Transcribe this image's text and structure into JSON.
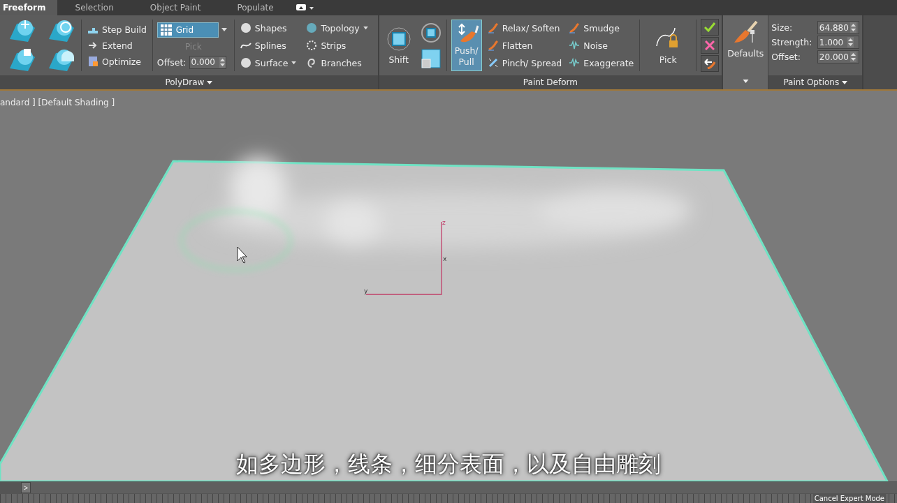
{
  "tabs": [
    {
      "label": "Freeform",
      "selected": true
    },
    {
      "label": "Selection",
      "selected": false
    },
    {
      "label": "Object Paint",
      "selected": false
    },
    {
      "label": "Populate",
      "selected": false
    }
  ],
  "polydraw": {
    "title": "PolyDraw",
    "tools": [
      {
        "label": "Step Build"
      },
      {
        "label": "Extend"
      },
      {
        "label": "Optimize"
      }
    ],
    "grid": {
      "label": "Grid"
    },
    "pick": {
      "label": "Pick",
      "disabled": true
    },
    "offset": {
      "label": "Offset:",
      "value": "0.000"
    },
    "draw_tools": [
      {
        "label": "Shapes",
        "dropdown": false
      },
      {
        "label": "Splines",
        "dropdown": false
      },
      {
        "label": "Surface",
        "dropdown": true
      },
      {
        "label": "Topology",
        "dropdown": true
      },
      {
        "label": "Strips",
        "dropdown": false
      },
      {
        "label": "Branches",
        "dropdown": false
      }
    ]
  },
  "paint_deform": {
    "title": "Paint Deform",
    "shift": "Shift",
    "push_pull": {
      "lines": [
        "Push/",
        "Pull"
      ],
      "selected": true
    },
    "brushes": [
      {
        "label": "Relax/ Soften"
      },
      {
        "label": "Flatten"
      },
      {
        "label": "Pinch/ Spread"
      },
      {
        "label": "Smudge"
      },
      {
        "label": "Noise"
      },
      {
        "label": "Exaggerate"
      }
    ],
    "pick": "Pick"
  },
  "defaults": {
    "label": "Defaults"
  },
  "paint_options": {
    "title": "Paint Options",
    "fields": [
      {
        "label": "Size:",
        "value": "64.880"
      },
      {
        "label": "Strength:",
        "value": "1.000"
      },
      {
        "label": "Offset:",
        "value": "20.000"
      }
    ]
  },
  "viewport": {
    "label": "andard ] [Default Shading ]",
    "axes": [
      "z",
      "x",
      "y"
    ]
  },
  "subtitle": "如多边形，线条，细分表面，以及自由雕刻",
  "status": {
    "expand": ">",
    "cancel": "Cancel Expert Mode"
  }
}
